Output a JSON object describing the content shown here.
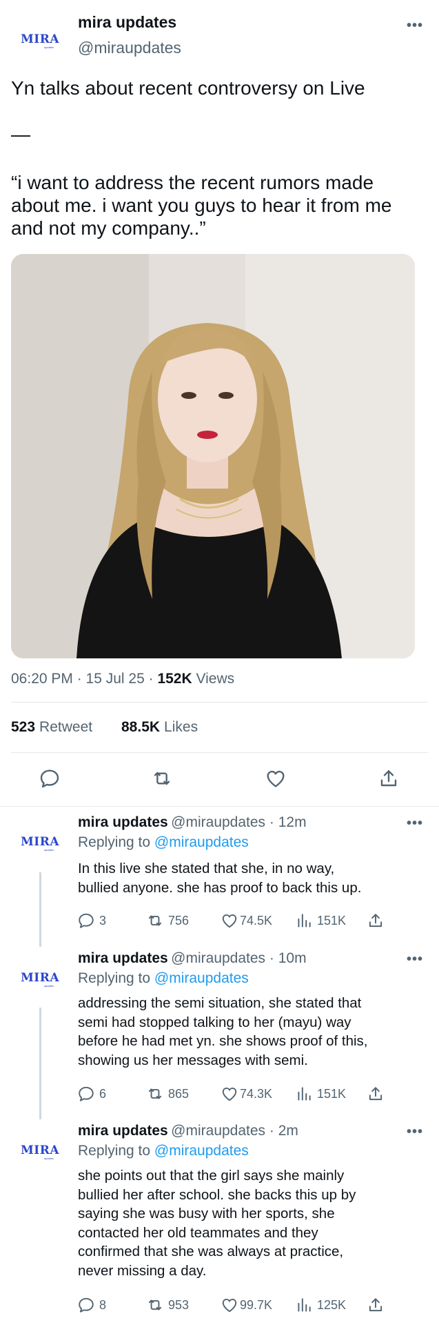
{
  "tweet": {
    "avatar_logo": "MIRA",
    "avatar_sub": "updates",
    "name": "mira updates",
    "handle": "@miraupdates",
    "text_line1": "Yn talks about recent controversy on Live",
    "dash": "—",
    "quote_line1": "“i want to address the recent rumors made",
    "quote_line2": "about me. i want you guys to hear it from me",
    "quote_line3": "and not my company..”",
    "time": "06:20 PM · 15 Jul 25 · ",
    "views_count": "152K",
    "views_label": " Views",
    "retweets_count": "523",
    "retweets_label": "Retweet",
    "likes_count": "88.5K",
    "likes_label": "Likes"
  },
  "replies": [
    {
      "name": "mira updates",
      "handle_time": "@miraupdates · 12m",
      "replying_prefix": "Replying to ",
      "replying_to": "@miraupdates",
      "lines": [
        "In this live she stated that she, in no way,",
        "bullied anyone. she has proof to back this up."
      ],
      "comments": "3",
      "retweets": "756",
      "likes": "74.5K",
      "views": "151K"
    },
    {
      "name": "mira updates",
      "handle_time": "@miraupdates · 10m",
      "replying_prefix": "Replying to ",
      "replying_to": "@miraupdates",
      "lines": [
        "addressing the semi situation, she stated that",
        "semi had stopped talking to her (mayu) way",
        "before he had met yn. she shows proof of this,",
        "showing us her messages with semi."
      ],
      "comments": "6",
      "retweets": "865",
      "likes": "74.3K",
      "views": "151K"
    },
    {
      "name": "mira updates",
      "handle_time": "@miraupdates · 2m",
      "replying_prefix": "Replying to ",
      "replying_to": "@miraupdates",
      "lines": [
        "she points out that the girl says she mainly",
        "bullied her after school. she backs this up by",
        "saying she was busy with her sports, she",
        "contacted her old teammates and they",
        "confirmed that she was always at practice,",
        "never missing a day."
      ],
      "comments": "8",
      "retweets": "953",
      "likes": "99.7K",
      "views": "125K"
    }
  ],
  "colors": {
    "link": "#1d9bf0",
    "muted": "#536471",
    "logo": "#2b45c9"
  },
  "icons": [
    "more-icon",
    "comment-icon",
    "retweet-icon",
    "like-icon",
    "share-icon",
    "views-icon"
  ]
}
